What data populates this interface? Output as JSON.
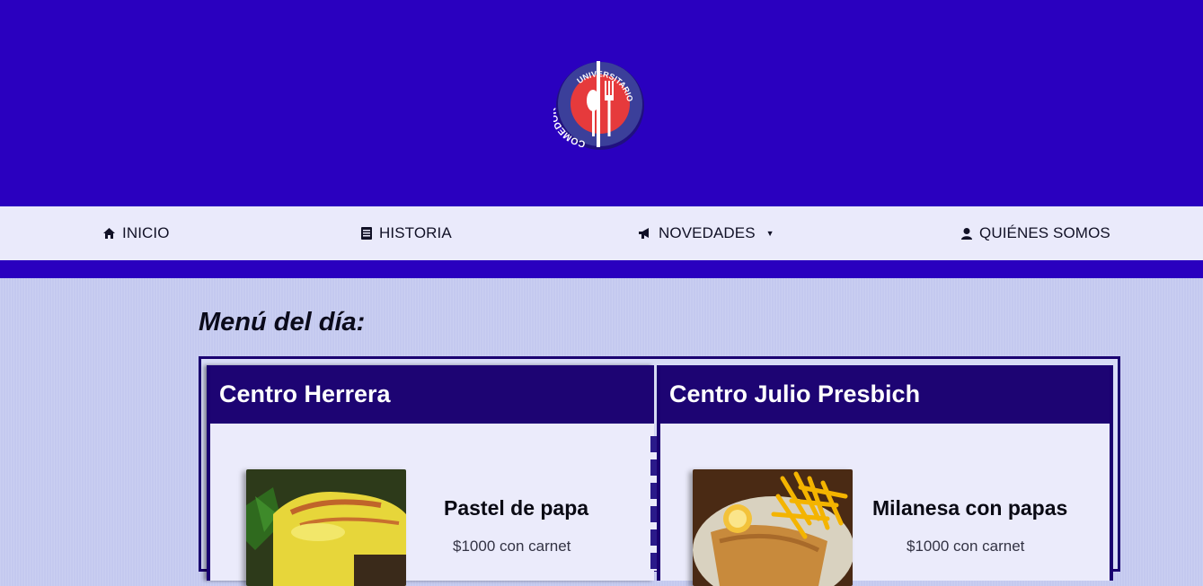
{
  "header": {
    "logo": {
      "text_top": "UNIVERSITARIO",
      "text_left": "COMEDOR",
      "icon": "fork-spoon-icon"
    }
  },
  "nav": {
    "items": [
      {
        "label": "INICIO",
        "icon": "home-icon"
      },
      {
        "label": "HISTORIA",
        "icon": "book-icon"
      },
      {
        "label": "NOVEDADES",
        "icon": "megaphone-icon",
        "caret": "▼"
      },
      {
        "label": "QUIÉNES SOMOS",
        "icon": "user-icon"
      }
    ]
  },
  "menu": {
    "title": "Menú del día:",
    "centers": [
      {
        "name": "Centro Herrera",
        "dish": "Pastel de papa",
        "price": "$1000 con carnet"
      },
      {
        "name": "Centro Julio Presbich",
        "dish": "Milanesa con papas",
        "price": "$1000 con carnet"
      }
    ]
  },
  "colors": {
    "header_bg": "#2a00bf",
    "nav_bg": "#eaeafb",
    "card_head_bg": "#1d0473",
    "page_bg": "#c4c9ef"
  }
}
